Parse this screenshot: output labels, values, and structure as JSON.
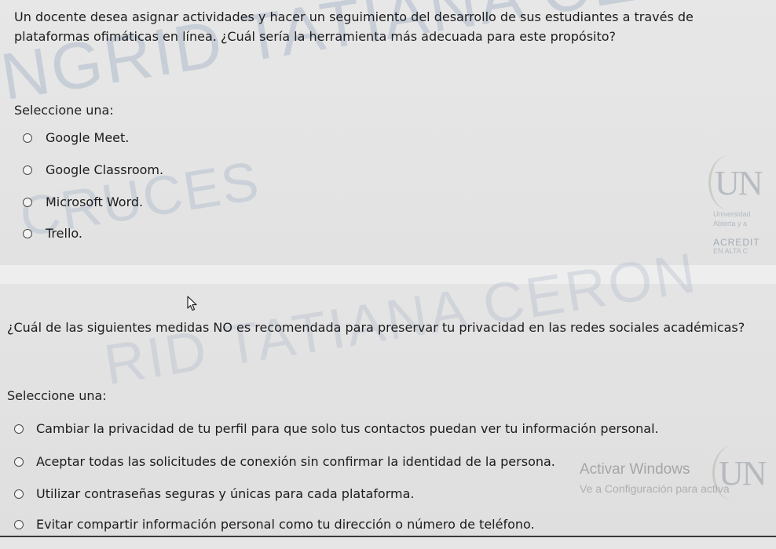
{
  "questions": [
    {
      "prompt": "Un docente desea asignar actividades y hacer un seguimiento del desarrollo de sus estudiantes a través de plataformas ofimáticas en línea. ¿Cuál sería la herramienta más adecuada para este propósito?",
      "select_label": "Seleccione una:",
      "options": [
        "Google Meet.",
        "Google Classroom.",
        "Microsoft Word.",
        "Trello."
      ]
    },
    {
      "prompt": "¿Cuál de las siguientes medidas NO es recomendada para preservar tu privacidad en las redes sociales académicas?",
      "select_label": "Seleccione una:",
      "options": [
        "Cambiar la privacidad de tu perfil para que solo tus contactos puedan ver tu información personal.",
        "Aceptar todas las solicitudes de conexión sin confirmar la identidad de la persona.",
        "Utilizar contraseñas seguras y únicas para cada plataforma.",
        "Evitar compartir información personal como tu dirección o número de teléfono."
      ]
    }
  ],
  "watermark": {
    "name_line_1": "NGRID TATIANA CERON",
    "surname_line_1": "CRUCES",
    "name_line_2": "RID TATIANA CERON"
  },
  "university_logo": {
    "mark": "UN",
    "line_1": "Universidad",
    "line_2": "Abierta y a",
    "accredit": "ACREDIT",
    "line_4": "EN ALTA C"
  },
  "windows_activation": {
    "title": "Activar Windows",
    "subtitle": "Ve a Configuración para activa"
  },
  "colors": {
    "background": "#e6e6e6",
    "text": "#1c1c1c",
    "watermark": "#8ca0b9"
  }
}
